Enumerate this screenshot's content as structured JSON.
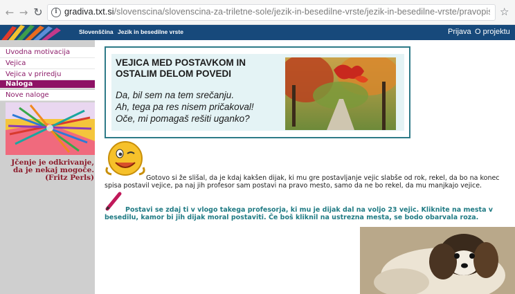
{
  "browser": {
    "url_host": "gradiva.txt.si",
    "url_path": "/slovenscina/slovenscina-za-triletne-sole/jezik-in-besedilne-vrste/jezik-in-besedilne-vrste/pravopis/locila-nekoncna-enod..."
  },
  "header": {
    "nav": [
      "Slovenščina",
      "Jezik in besedilne vrste"
    ],
    "right": [
      "Prijava",
      "O projektu"
    ],
    "color": "#17497b"
  },
  "sidebar": {
    "items": [
      {
        "label": "Uvodna motivacija",
        "active": false
      },
      {
        "label": "Vejica",
        "active": false
      },
      {
        "label": "Vejica v priredju",
        "active": false
      },
      {
        "label": "Naloga",
        "active": true
      },
      {
        "label": "Nove naloge",
        "active": false
      }
    ],
    "quote": "Jčenje je odkrivanje, da je nekaj mogoče. (Fritz Perls)",
    "accent": "#8e1265"
  },
  "banner": {
    "title": "VEJICA MED POSTAVKOM IN OSTALIM DELOM POVEDI",
    "lines": [
      "Da, bil sem na tem srečanju.",
      "Ah, tega pa res nisem pričakoval!",
      "Oče, mi pomagaš rešiti uganko?"
    ]
  },
  "content": {
    "paragraph": "Gotovo si že slišal, da je kdaj kakšen dijak, ki mu gre postavljanje vejic slabše od rok, rekel, da bo na konec spisa postavil vejice, pa naj jih profesor sam postavi na pravo mesto, samo da ne bo rekel, da mu manjkajo vejice.",
    "task": "Postavi se zdaj ti v vlogo takega profesorja, ki mu je dijak dal na voljo 23 vejic. Kliknite na mesta v besedilu, kamor bi jih dijak moral postaviti. Če boš kliknil na ustrezna mesta, se bodo obarvala roza.",
    "task_color": "#1f7a83"
  }
}
